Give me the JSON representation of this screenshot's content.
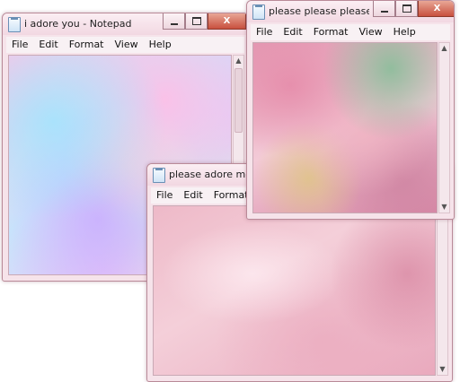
{
  "windows": [
    {
      "title": "i adore you - Notepad",
      "menu": [
        "File",
        "Edit",
        "Format",
        "View",
        "Help"
      ],
      "content": "iridescent pastel holographic background"
    },
    {
      "title": "please please please ...",
      "menu": [
        "File",
        "Edit",
        "Format",
        "View",
        "Help"
      ],
      "content": "pink lily flower photo"
    },
    {
      "title": "please adore me",
      "menu": [
        "File",
        "Edit",
        "Format"
      ],
      "content": "pink soft-focus sparkle photo with moon"
    }
  ],
  "controls": {
    "minimize": "–",
    "maximize": "□",
    "close": "X"
  },
  "icons": {
    "app": "notepad-icon",
    "scroll_up": "▲",
    "scroll_down": "▼"
  },
  "colors": {
    "frame": "#f6e3ea",
    "close_button": "#c8503e"
  }
}
